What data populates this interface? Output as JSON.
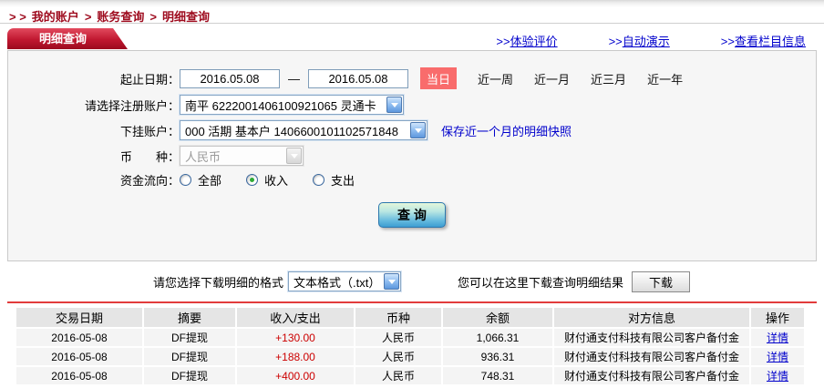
{
  "breadcrumb": {
    "prefix": "> >",
    "separator": ">",
    "items": [
      "我的账户",
      "账务查询",
      "明细查询"
    ]
  },
  "header": {
    "tab": "明细查询",
    "links": [
      {
        "prefix": ">>",
        "label": "体验评价"
      },
      {
        "prefix": ">>",
        "label": "自动演示"
      },
      {
        "prefix": ">>",
        "label": "查看栏目信息"
      }
    ]
  },
  "form": {
    "date_label": "起止日期：",
    "date_from": "2016.05.08",
    "date_dash": "—",
    "date_to": "2016.05.08",
    "today": "当日",
    "quick_ranges": [
      "近一周",
      "近一月",
      "近三月",
      "近一年"
    ],
    "account_label": "请选择注册账户：",
    "account_value": "南平  6222001406100921065  灵通卡",
    "sub_label": "下挂账户：",
    "sub_value": "000  活期  基本户  1406600101102571848",
    "snapshot_link": "保存近一个月的明细快照",
    "currency_label": "币　　种：",
    "currency_value": "人民币",
    "flow_label": "资金流向：",
    "flow_options": [
      {
        "label": "全部",
        "checked": false
      },
      {
        "label": "收入",
        "checked": true
      },
      {
        "label": "支出",
        "checked": false
      }
    ],
    "query_button": "查 询"
  },
  "download": {
    "format_label": "请您选择下载明细的格式",
    "format_value": "文本格式（.txt）",
    "result_label": "您可以在这里下载查询明细结果",
    "button": "下载"
  },
  "table": {
    "headers": [
      "交易日期",
      "摘要",
      "收入/支出",
      "币种",
      "余额",
      "对方信息",
      "操作"
    ],
    "rows": [
      {
        "date": "2016-05-08",
        "summary": "DF提现",
        "amount": "+130.00",
        "currency": "人民币",
        "balance": "1,066.31",
        "counterparty": "财付通支付科技有限公司客户备付金",
        "action": "详情"
      },
      {
        "date": "2016-05-08",
        "summary": "DF提现",
        "amount": "+188.00",
        "currency": "人民币",
        "balance": "936.31",
        "counterparty": "财付通支付科技有限公司客户备付金",
        "action": "详情"
      },
      {
        "date": "2016-05-08",
        "summary": "DF提现",
        "amount": "+400.00",
        "currency": "人民币",
        "balance": "748.31",
        "counterparty": "财付通支付科技有限公司客户备付金",
        "action": "详情"
      }
    ]
  },
  "colors": {
    "breadcrumb_red": "#9e0b1e",
    "tab_red": "#b00d24",
    "link_blue": "#0000cc",
    "today_bg": "#f96c6c",
    "amount_red": "#cc0000",
    "divider_red": "#e23b3b",
    "table_header_bg": "#e5e5e5",
    "table_row_bg": "#f4f4f4"
  }
}
